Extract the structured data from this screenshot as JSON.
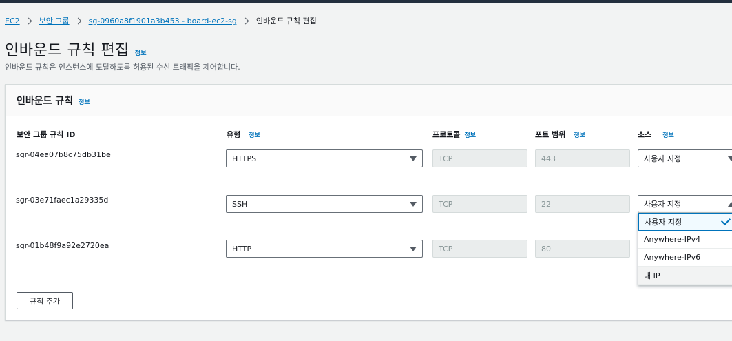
{
  "breadcrumb": {
    "items": [
      "EC2",
      "보안 그룹",
      "sg-0960a8f1901a3b453 - board-ec2-sg"
    ],
    "current": "인바운드 규칙 편집"
  },
  "page": {
    "title": "인바운드 규칙 편집",
    "info": "정보",
    "description": "인바운드 규칙은 인스턴스에 도달하도록 허용된 수신 트래픽을 제어합니다."
  },
  "panel": {
    "title": "인바운드 규칙",
    "info": "정보",
    "columns": {
      "rule_id": "보안 그룹 규칙 ID",
      "type": "유형",
      "protocol": "프로토콜",
      "port_range": "포트 범위",
      "source": "소스",
      "info": "정보"
    },
    "rules": [
      {
        "id": "sgr-04ea07b8c75db31be",
        "type": "HTTPS",
        "protocol": "TCP",
        "port": "443",
        "source": "사용자 지정"
      },
      {
        "id": "sgr-03e71faec1a29335d",
        "type": "SSH",
        "protocol": "TCP",
        "port": "22",
        "source": "사용자 지정"
      },
      {
        "id": "sgr-01b48f9a92e2720ea",
        "type": "HTTP",
        "protocol": "TCP",
        "port": "80",
        "source": ""
      }
    ],
    "source_options": [
      "사용자 지정",
      "Anywhere-IPv4",
      "Anywhere-IPv6",
      "내 IP"
    ],
    "add_rule_label": "규칙 추가"
  },
  "colors": {
    "link": "#0073bb",
    "header_bar": "#232f3e",
    "background": "#f2f3f3"
  }
}
